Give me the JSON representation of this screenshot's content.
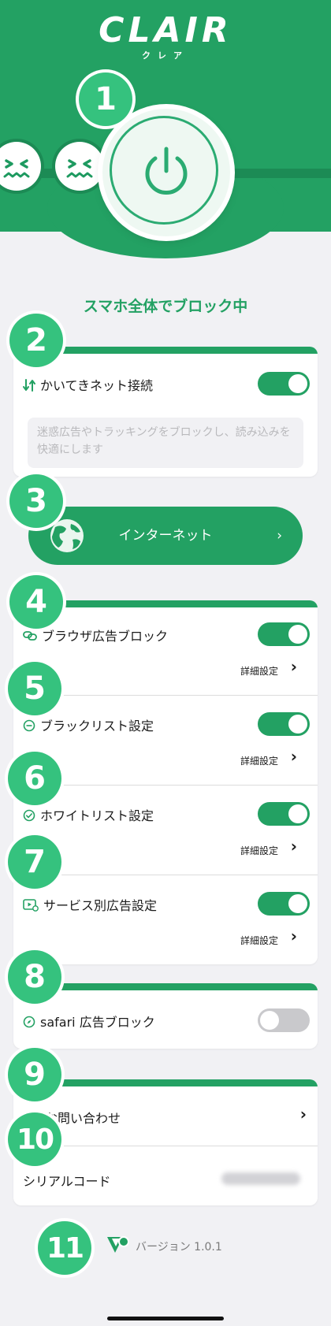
{
  "header": {
    "logo": "CLAIR",
    "logo_sub": "クレア"
  },
  "badges": [
    "1",
    "2",
    "3",
    "4",
    "5",
    "6",
    "7",
    "8",
    "9",
    "10",
    "11"
  ],
  "status_text": "スマホ全体でブロック中",
  "comfort": {
    "label": "かいてきネット接続",
    "toggle_on": true,
    "description": "迷惑広告やトラッキングをブロックし、読み込みを快適にします"
  },
  "network": {
    "label": "インターネット",
    "chevron": "›"
  },
  "settings": {
    "items": [
      {
        "label": "ブラウザ広告ブロック",
        "icon": "link-icon",
        "toggle_on": true,
        "detail": "詳細設定"
      },
      {
        "label": "ブラックリスト設定",
        "icon": "minus-circle-icon",
        "toggle_on": true,
        "detail": "詳細設定"
      },
      {
        "label": "ホワイトリスト設定",
        "icon": "check-circle-icon",
        "toggle_on": true,
        "detail": "詳細設定"
      },
      {
        "label": "サービス別広告設定",
        "icon": "video-settings-icon",
        "toggle_on": true,
        "detail": "詳細設定"
      }
    ],
    "chevron": "›"
  },
  "safari": {
    "label": "safari 広告ブロック",
    "icon": "compass-icon",
    "toggle_on": false
  },
  "support": {
    "contact_label": "お問い合わせ",
    "serial_label": "シリアルコード",
    "chevron": "›"
  },
  "footer": {
    "version": "バージョン 1.0.1"
  },
  "colors": {
    "brand": "#23a163",
    "badge": "#35c27e",
    "background": "#f1f1f4"
  }
}
